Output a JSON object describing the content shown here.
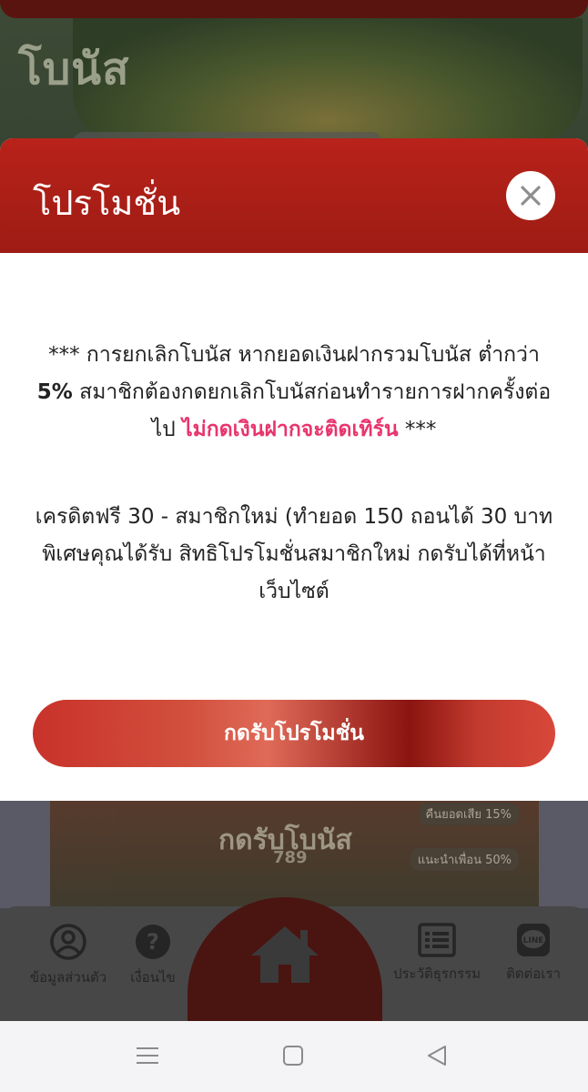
{
  "background": {
    "top_title": "โบนัส",
    "banner_title": "กดรับโบนัส",
    "banner_sub": "789",
    "banner_tag1": "คืนยอดเสีย 15%",
    "banner_tag2": "แนะนำเพื่อน 50%"
  },
  "bottom_nav": {
    "items": [
      {
        "label": "ข้อมูลส่วนตัว",
        "icon": "user-circle-icon"
      },
      {
        "label": "เงื่อนไข",
        "icon": "question-icon"
      },
      {
        "label": "ประวัติธุรกรรม",
        "icon": "list-icon"
      },
      {
        "label": "ติดต่อเรา",
        "icon": "line-chat-icon"
      }
    ],
    "home_icon": "home-icon"
  },
  "modal": {
    "title": "โปรโมชั่น",
    "close_icon": "close-icon",
    "para1_a": "*** การยกเลิกโบนัส หากยอดเงินฝากรวมโบนัส ต่ำกว่า ",
    "para1_bold": "5%",
    "para1_b": " สมาชิกต้องกดยกเลิกโบนัสก่อนทำรายการฝากครั้งต่อไป ",
    "para1_pink": "ไม่กดเงินฝากจะติดเทิร์น",
    "para1_c": " ***",
    "para2": "เครดิตฟรี 30 - สมาชิกใหม่ (ทำยอด 150 ถอนได้ 30 บาท พิเศษคุณได้รับ สิทธิโปรโมชั่นสมาชิกใหม่ กดรับได้ที่หน้าเว็บไซต์",
    "cta_label": "กดรับโปรโมชั่น"
  },
  "colors": {
    "header_red": "#b8221a",
    "highlight_pink": "#e8356e"
  }
}
